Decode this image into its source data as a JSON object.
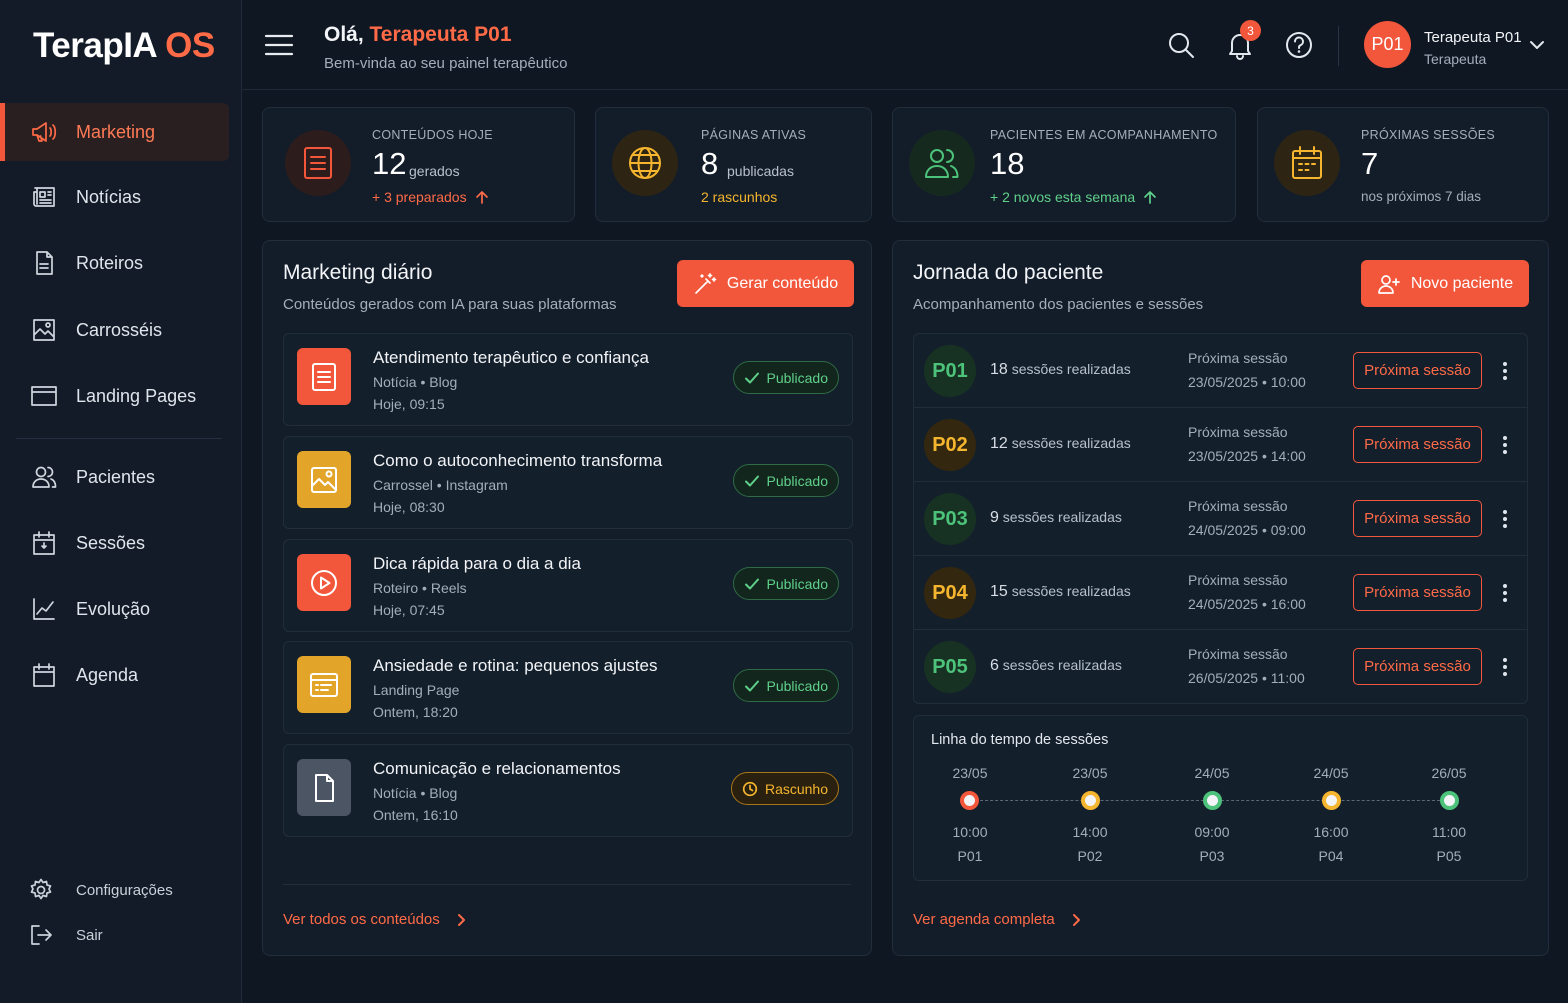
{
  "brand": {
    "name_part1": "TerapIA",
    "name_part2": "OS"
  },
  "sidebar": {
    "items": [
      {
        "label": "Marketing",
        "icon": "megaphone-icon",
        "active": true
      },
      {
        "label": "Notícias",
        "icon": "newspaper-icon"
      },
      {
        "label": "Roteiros",
        "icon": "document-icon"
      },
      {
        "label": "Carrosséis",
        "icon": "image-icon"
      },
      {
        "label": "Landing Pages",
        "icon": "browser-window-icon"
      },
      {
        "label": "Pacientes",
        "icon": "users-icon"
      },
      {
        "label": "Sessões",
        "icon": "calendar-session-icon"
      },
      {
        "label": "Evolução",
        "icon": "line-chart-icon"
      },
      {
        "label": "Agenda",
        "icon": "calendar-icon"
      }
    ],
    "bottom": [
      {
        "label": "Configurações",
        "icon": "gear-icon"
      },
      {
        "label": "Sair",
        "icon": "logout-icon"
      }
    ]
  },
  "header": {
    "greeting": "Olá,",
    "user_highlight": "Terapeuta P01",
    "subtitle": "Bem-vinda ao seu painel terapêutico",
    "notification_count": "3",
    "avatar_initials": "P01",
    "user_name": "Terapeuta P01",
    "user_role": "Terapeuta"
  },
  "stats": [
    {
      "label": "CONTEÚDOS HOJE",
      "value": "12",
      "unit": "gerados",
      "sub": "+ 3 preparados",
      "sub_color": "#ff6a47",
      "icon": "document-list-icon",
      "accent": "#f2563b"
    },
    {
      "label": "PÁGINAS ATIVAS",
      "value": "8",
      "unit": "publicadas",
      "sub": "2 rascunhos",
      "sub_color": "#f5b52e",
      "icon": "globe-icon",
      "accent": "#f5b52e"
    },
    {
      "label": "PACIENTES EM ACOMPANHAMENTO",
      "value": "18",
      "unit": "",
      "sub": "+ 2 novos esta semana",
      "sub_color": "#5fd08a",
      "icon": "users-icon",
      "accent": "#4cc27a"
    },
    {
      "label": "PRÓXIMAS SESSÕES",
      "value": "7",
      "unit": "",
      "sub": "nos próximos 7 dias",
      "sub_color": "#a4aebb",
      "icon": "calendar-icon",
      "accent": "#f5b52e"
    }
  ],
  "marketing": {
    "title": "Marketing diário",
    "subtitle": "Conteúdos gerados com IA para suas plataformas",
    "button": "Gerar conteúdo",
    "items": [
      {
        "title": "Atendimento terapêutico e confiança",
        "type": "Notícia",
        "platform": "Blog",
        "time": "Hoje, 09:15",
        "status": "Publicado",
        "status_kind": "published",
        "thumb_color": "#f2563b",
        "icon": "document-list-icon"
      },
      {
        "title": "Como o autoconhecimento transforma",
        "type": "Carrossel",
        "platform": "Instagram",
        "time": "Hoje, 08:30",
        "status": "Publicado",
        "status_kind": "published",
        "thumb_color": "#e3a42a",
        "icon": "image-icon"
      },
      {
        "title": "Dica rápida para o dia a dia",
        "type": "Roteiro",
        "platform": "Reels",
        "time": "Hoje, 07:45",
        "status": "Publicado",
        "status_kind": "published",
        "thumb_color": "#f2563b",
        "icon": "play-circle-icon"
      },
      {
        "title": "Ansiedade e rotina: pequenos ajustes",
        "type": "Landing Page",
        "platform": "",
        "time": "Ontem, 18:20",
        "status": "Publicado",
        "status_kind": "published",
        "thumb_color": "#e3a42a",
        "icon": "browser-window-icon"
      },
      {
        "title": "Comunicação e relacionamentos",
        "type": "Notícia",
        "platform": "Blog",
        "time": "Ontem, 16:10",
        "status": "Rascunho",
        "status_kind": "draft",
        "thumb_color": "#4b5563",
        "icon": "document-icon"
      }
    ],
    "link": "Ver todos os conteúdos"
  },
  "journey": {
    "title": "Jornada do paciente",
    "subtitle": "Acompanhamento dos pacientes e sessões",
    "button": "Novo paciente",
    "next_label": "Próxima sessão",
    "patients": [
      {
        "id": "P01",
        "count": "18",
        "count_label": "sessões realizadas",
        "next_date": "23/05/2025 • 10:00",
        "color": "#4cc27a",
        "bg": "#173222"
      },
      {
        "id": "P02",
        "count": "12",
        "count_label": "sessões realizadas",
        "next_date": "23/05/2025 • 14:00",
        "color": "#f5b52e",
        "bg": "#33270f"
      },
      {
        "id": "P03",
        "count": "9",
        "count_label": "sessões realizadas",
        "next_date": "24/05/2025 • 09:00",
        "color": "#4cc27a",
        "bg": "#173222"
      },
      {
        "id": "P04",
        "count": "15",
        "count_label": "sessões realizadas",
        "next_date": "24/05/2025 • 16:00",
        "color": "#f5b52e",
        "bg": "#33270f"
      },
      {
        "id": "P05",
        "count": "6",
        "count_label": "sessões realizadas",
        "next_date": "26/05/2025 • 11:00",
        "color": "#4cc27a",
        "bg": "#173222"
      }
    ],
    "timeline": {
      "title": "Linha do tempo de sessões",
      "points": [
        {
          "date": "23/05",
          "time": "10:00",
          "patient": "P01",
          "color": "#f2563b"
        },
        {
          "date": "23/05",
          "time": "14:00",
          "patient": "P02",
          "color": "#f5b52e"
        },
        {
          "date": "24/05",
          "time": "09:00",
          "patient": "P03",
          "color": "#4cc27a"
        },
        {
          "date": "24/05",
          "time": "16:00",
          "patient": "P04",
          "color": "#f5b52e"
        },
        {
          "date": "26/05",
          "time": "11:00",
          "patient": "P05",
          "color": "#4cc27a"
        }
      ]
    },
    "link": "Ver agenda completa"
  }
}
